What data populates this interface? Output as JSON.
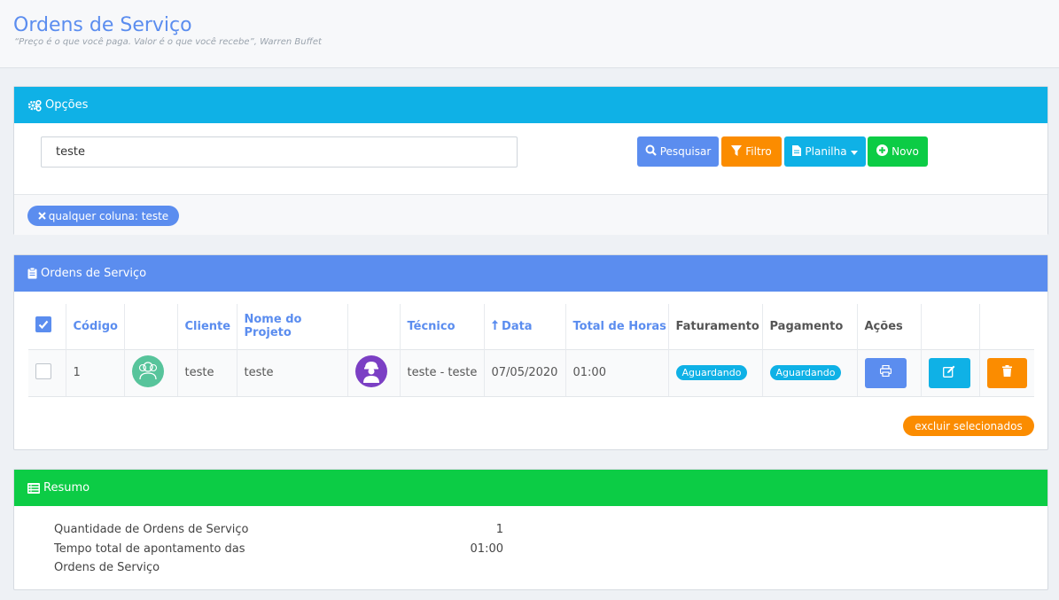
{
  "header": {
    "title": "Ordens de Serviço",
    "subtitle": "“Preço é o que você paga. Valor é o que você recebe”, Warren Buffet"
  },
  "options_panel": {
    "title": "Opções",
    "search_value": "teste",
    "buttons": {
      "search": "Pesquisar",
      "filter": "Filtro",
      "spreadsheet": "Planilha",
      "new": "Novo"
    },
    "active_filter": "qualquer coluna: teste"
  },
  "orders_panel": {
    "title": "Ordens de Serviço",
    "columns": [
      "Código",
      "Cliente",
      "Nome do Projeto",
      "Técnico",
      "Data",
      "Total de Horas",
      "Faturamento",
      "Pagamento",
      "Ações"
    ],
    "rows": [
      {
        "codigo": "1",
        "cliente": "teste",
        "projeto": "teste",
        "tecnico": "teste - teste",
        "data": "07/05/2020",
        "horas": "01:00",
        "faturamento": "Aguardando",
        "pagamento": "Aguardando"
      }
    ],
    "bulk_delete": "excluir selecionados"
  },
  "summary_panel": {
    "title": "Resumo",
    "items": [
      {
        "label": "Quantidade de Ordens de Serviço",
        "value": "1"
      },
      {
        "label": "Tempo total de apontamento das Ordens de Serviço",
        "value": "01:00"
      }
    ]
  },
  "colors": {
    "primary": "#5b8def",
    "info": "#0fb1e6",
    "warning": "#fb8c00",
    "success": "#0ccc45"
  }
}
